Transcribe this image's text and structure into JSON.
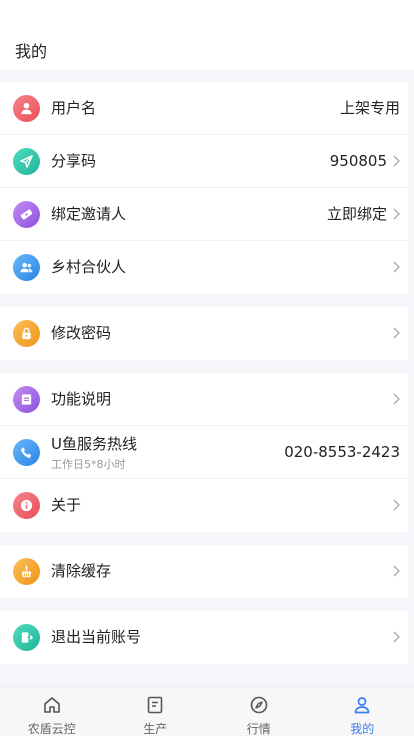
{
  "header": {
    "title": "我的"
  },
  "groups": [
    {
      "rows": [
        {
          "label": "用户名",
          "value": "上架专用",
          "icon": "user-icon",
          "color": "#f0676f"
        },
        {
          "label": "分享码",
          "value": "950805",
          "icon": "send-icon",
          "color": "#2fc8a8"
        },
        {
          "label": "绑定邀请人",
          "value": "立即绑定",
          "icon": "ticket-icon",
          "color": "#a96de6"
        },
        {
          "label": "乡村合伙人",
          "value": "",
          "icon": "users-icon",
          "color": "#3b9af0"
        }
      ]
    },
    {
      "rows": [
        {
          "label": "修改密码",
          "value": "",
          "icon": "lock-icon",
          "color": "#f5a623"
        }
      ]
    },
    {
      "rows": [
        {
          "label": "功能说明",
          "value": "",
          "icon": "document-icon",
          "color": "#a96de6"
        },
        {
          "label": "U鱼服务热线",
          "sublabel": "工作日5*8小时",
          "value": "020-8553-2423",
          "icon": "phone-icon",
          "color": "#3b9af0"
        },
        {
          "label": "关于",
          "value": "",
          "icon": "info-icon",
          "color": "#f0676f"
        }
      ]
    },
    {
      "rows": [
        {
          "label": "清除缓存",
          "value": "",
          "icon": "clean-icon",
          "color": "#f5a623"
        }
      ]
    },
    {
      "rows": [
        {
          "label": "退出当前账号",
          "value": "",
          "icon": "logout-icon",
          "color": "#2fc8a8"
        }
      ]
    }
  ],
  "tabs": [
    {
      "label": "农盾云控",
      "icon": "home-icon"
    },
    {
      "label": "生产",
      "icon": "edit-icon"
    },
    {
      "label": "行情",
      "icon": "compass-icon"
    },
    {
      "label": "我的",
      "icon": "profile-icon",
      "active": true
    }
  ],
  "colors": {
    "accent": "#3b7ff3",
    "background": "#f5f6fa"
  }
}
